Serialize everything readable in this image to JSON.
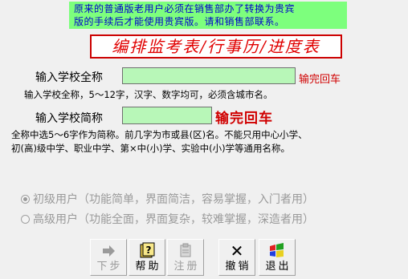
{
  "notice": {
    "line1": "原来的普通版老用户必须在销售部办了转换为贵宾",
    "line2": "版的手续后才能使用贵宾版。请和销售部联系。"
  },
  "banner": "编排监考表/行事历/进度表",
  "school_full": {
    "label": "输入学校全称",
    "value": "",
    "hint_right": "输完回车",
    "hint_below": "输入学校全称，5～12字，汉字、数字均可，必须含城市名。"
  },
  "school_short": {
    "label": "输入学校简称",
    "value": "",
    "hint_right": "输完回车",
    "desc1": "全称中选5～6字作为简称。前几字为市或县(区)名。不能只用中心小学、",
    "desc2": "初(高)级中学、职业中学、第×中(小)学、实验中(小)学等通用名称。"
  },
  "user_type": {
    "options": [
      {
        "label": "初级用户（功能简单，界面简洁，容易掌握，入门者用）",
        "selected": true
      },
      {
        "label": "高级用户（功能全面，界面复杂，较难掌握，深造者用）",
        "selected": false
      }
    ]
  },
  "toolbar": {
    "buttons": [
      {
        "label": "下步",
        "icon": "arrow-right-icon",
        "enabled": false
      },
      {
        "label": "帮助",
        "icon": "help-book-icon",
        "enabled": true
      },
      {
        "label": "注册",
        "icon": "register-icon",
        "enabled": false
      },
      {
        "label": "撤销",
        "icon": "undo-x-icon",
        "enabled": true
      },
      {
        "label": "退出",
        "icon": "exit-icon",
        "enabled": true
      }
    ]
  },
  "colors": {
    "notice_bg": "#7dff7d",
    "notice_text": "#0000cc",
    "banner_text": "#e00000",
    "input_bg": "#b8f7b8",
    "hint_red": "#d00000",
    "disabled": "#9a9a9a"
  }
}
